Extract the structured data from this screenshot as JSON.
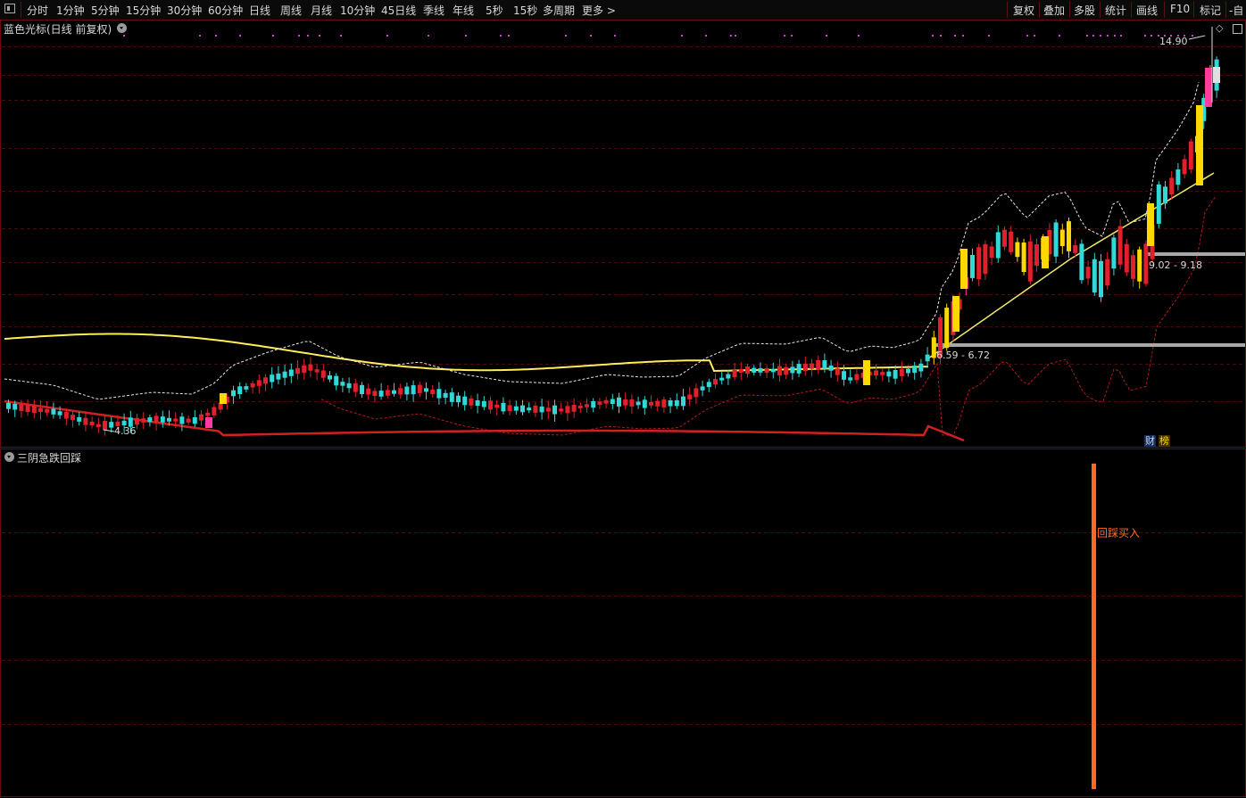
{
  "toolbar": {
    "periods": [
      "分时",
      "1分钟",
      "5分钟",
      "15分钟",
      "30分钟",
      "60分钟",
      "日线",
      "周线",
      "月线",
      "10分钟",
      "45日线",
      "季线",
      "年线",
      "5秒",
      "15秒",
      "多周期",
      "更多 >"
    ],
    "actions": [
      "复权",
      "叠加",
      "多股",
      "统计",
      "画线",
      "F10",
      "标记",
      "-自"
    ]
  },
  "main_panel": {
    "title": "蓝色光标(日线 前复权)",
    "labels": {
      "high_price": "14.90",
      "low_price": "4.36",
      "gap_upper": "9.02 - 9.18",
      "gap_lower": "6.59 - 6.72"
    },
    "badges": {
      "finance": "财",
      "ranking": "榜"
    },
    "colors": {
      "up": "#e0202a",
      "down": "#30d8d8",
      "gold": "#ffd800",
      "pink": "#ff3c9c",
      "ma": "#f0e868",
      "band_lower": "#d02020",
      "support": "#a8a8a8"
    }
  },
  "sub_panel": {
    "title": "三阴急跌回踩",
    "signal_label": "回踩买入",
    "signal_color": "#ff6a20"
  }
}
